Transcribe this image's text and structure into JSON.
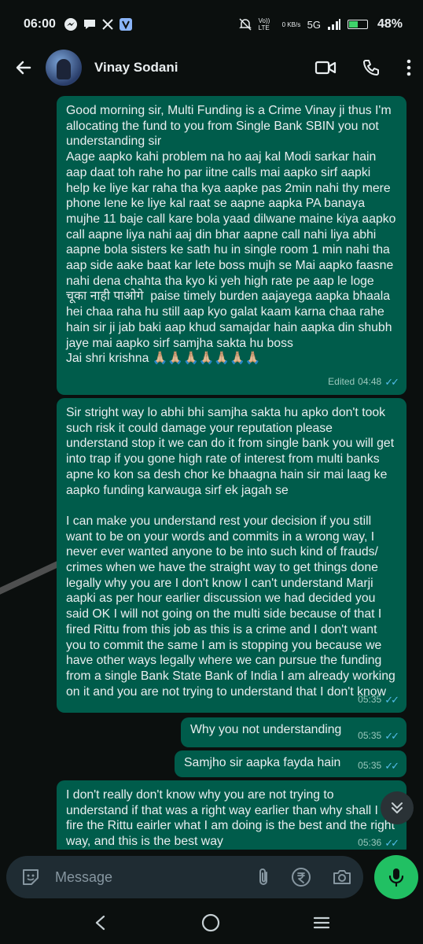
{
  "status_bar": {
    "time": "06:00",
    "net_label": "Vo)) LTE",
    "speed": "0 KB/s",
    "signal": "5G",
    "battery_pct": "48%",
    "battery_level": 0.48
  },
  "header": {
    "contact_name": "Vinay Sodani"
  },
  "messages": [
    {
      "text": "Good morning sir, Multi Funding is a Crime Vinay ji thus I'm allocating the fund to you from Single Bank SBIN you not understanding sir\nAage aapko kahi problem na ho aaj kal Modi sarkar hain aap daat toh rahe ho par iitne calls mai aapko sirf aapki help ke liye kar raha tha kya aapke pas 2min nahi thy mere phone lene ke liye kal raat se aapne aapka PA banaya mujhe 11 baje call kare bola yaad dilwane maine kiya aapko call aapne liya nahi aaj din bhar aapne call nahi liya abhi aapne bola sisters ke sath hu in single room 1 min nahi tha aap side aake baat kar lete boss mujh se Mai aapko faasne nahi dena chahta tha kyo ki yeh high rate pe aap le loge चूका नाही पाओगे  paise timely burden aajayega aapka bhaala hei chaa raha hu still aap kyo galat kaam karna chaa rahe hain sir ji jab baki aap khud samajdar hain aapka din shubh jaye mai aapko sirf samjha sakta hu boss\nJai shri krishna 🙏🏼🙏🏼🙏🏼🙏🏼🙏🏼🙏🏼🙏🏼",
      "edited": "Edited",
      "time": "04:48"
    },
    {
      "text": "Sir stright way lo abhi bhi samjha sakta hu apko don't took such risk it could damage your reputation please understand stop it we can do it from single bank you will get into trap if you gone high rate of interest from multi banks apne ko kon sa desh chor ke bhaagna hain sir mai laag ke aapko funding karwauga sirf ek jagah se\n\nI can make you understand rest your decision if you still want to be on your words and commits in a wrong way, I never ever wanted anyone to be into such kind of frauds/ crimes when we have the straight way to get things done legally why you are I don't know I can't understand Marji aapki as per hour earlier discussion we had decided you said OK I will not going on the multi side because of that I fired Rittu from this job as this is a crime and I don't want you to commit the same I am is stopping you because we have other ways legally where we can pursue the funding from a single Bank State Bank of India I am already working on it and you are not trying to understand that I don't know",
      "time": "05:35"
    },
    {
      "text": "Why you not understanding",
      "time": "05:35"
    },
    {
      "text": "Samjho sir aapka fayda hain",
      "time": "05:35"
    },
    {
      "text": "I don't really don't know why you are not trying to understand if that was a right way earlier than why shall I fire the Rittu eairler what I am doing is the best and the right way, and this is the best way",
      "time": "05:36"
    }
  ],
  "composer": {
    "placeholder": "Message"
  },
  "colors": {
    "outgoing_bubble": "#005c4b",
    "background": "#0b0f0e",
    "accent_green": "#21c063",
    "read_ticks": "#53bdeb"
  },
  "icons": [
    "back-arrow-icon",
    "video-call-icon",
    "phone-icon",
    "more-vert-icon",
    "sticker-icon",
    "attach-icon",
    "rupee-icon",
    "camera-icon",
    "mic-icon",
    "chevron-double-down-icon",
    "nav-back-icon",
    "nav-home-icon",
    "nav-recents-icon"
  ]
}
